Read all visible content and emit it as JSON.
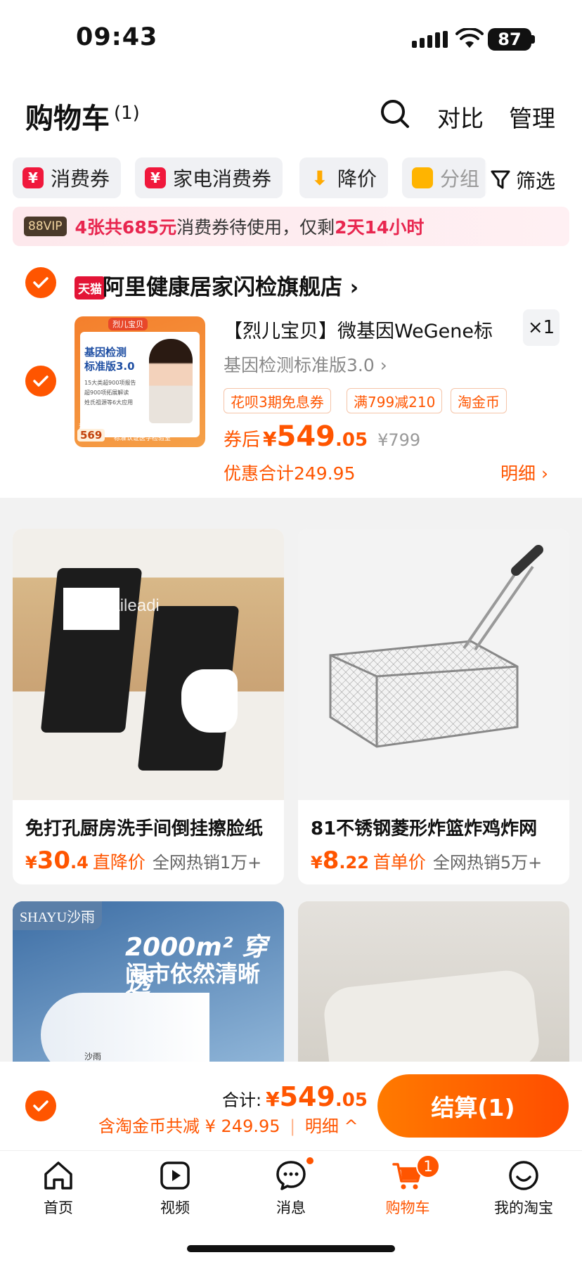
{
  "status_bar": {
    "time": "09:43",
    "battery": "87"
  },
  "header": {
    "title": "购物车",
    "count": "(1)",
    "compare": "对比",
    "manage": "管理"
  },
  "filters": {
    "chips": [
      {
        "label": "消费券",
        "icon": "coupon-icon",
        "icon_glyph": "¥",
        "color": "#f0183c"
      },
      {
        "label": "家电消费券",
        "icon": "coupon-icon",
        "icon_glyph": "¥",
        "color": "#f0183c"
      },
      {
        "label": "降价",
        "icon": "price-drop-icon",
        "icon_glyph": "⬇",
        "color": "#ffaa00"
      },
      {
        "label": "分组",
        "icon": "folder-icon",
        "icon_glyph": "▬",
        "color": "#ffb400"
      }
    ],
    "filter_label": "筛选"
  },
  "coupon_banner": {
    "vip": "88VIP",
    "highlight1": "4张共685元",
    "text1": "消费券待使用，仅剩",
    "highlight2": "2天14小时"
  },
  "shop": {
    "badge": "天猫",
    "name": "阿里健康居家闪检旗舰店",
    "product": {
      "title": "【烈儿宝贝】微基因WeGene标",
      "quantity": "×1",
      "sku": "基因检测标准版3.0",
      "image_text": {
        "top": "烈儿宝贝",
        "heading1": "基因检测",
        "heading2": "标准版3.0",
        "bullets": [
          "15大类超900项报告",
          "超900项拓展解读",
          "姓氏祖源等6大应用"
        ],
        "price_label": "烈儿专享价",
        "price": "569",
        "footer": "标准认证医学检验室"
      },
      "tags": [
        "花呗3期免息券",
        "满799减210",
        "淘金币"
      ],
      "price_prefix": "券后",
      "currency": "¥",
      "price_int": "549",
      "price_dec": ".05",
      "original_price": "¥799",
      "discount_total": "优惠合计249.95",
      "detail": "明细 ›"
    }
  },
  "recommendations": [
    {
      "name": "免打孔厨房洗手间倒挂擦脸纸",
      "currency": "¥",
      "price_int": "30",
      "price_dec": ".4",
      "price_tag": "直降价",
      "sales": "全网热销1万+",
      "watermark": "Kuaileadi"
    },
    {
      "name": "81不锈钢菱形炸篮炸鸡炸网",
      "currency": "¥",
      "price_int": "8",
      "price_dec": ".22",
      "price_tag": "首单价",
      "sales": "全网热销5万+"
    },
    {
      "brand": "SHAYU沙雨",
      "ad_line1": "2000m² 穿透",
      "ad_line2": "闹市依然清晰",
      "product_logo": "沙雨"
    },
    {}
  ],
  "checkout": {
    "total_label": "合计:",
    "currency": "¥",
    "total_int": "549",
    "total_dec": ".05",
    "saving": "含淘金币共减 ¥ 249.95",
    "saving_detail": "明细",
    "pay_button": "结算(1)"
  },
  "tabbar": {
    "items": [
      {
        "label": "首页",
        "icon": "home-icon"
      },
      {
        "label": "视频",
        "icon": "video-icon"
      },
      {
        "label": "消息",
        "icon": "message-icon"
      },
      {
        "label": "购物车",
        "icon": "cart-icon"
      },
      {
        "label": "我的淘宝",
        "icon": "profile-icon"
      }
    ],
    "cart_badge": "1",
    "active_color": "#ff5500"
  }
}
